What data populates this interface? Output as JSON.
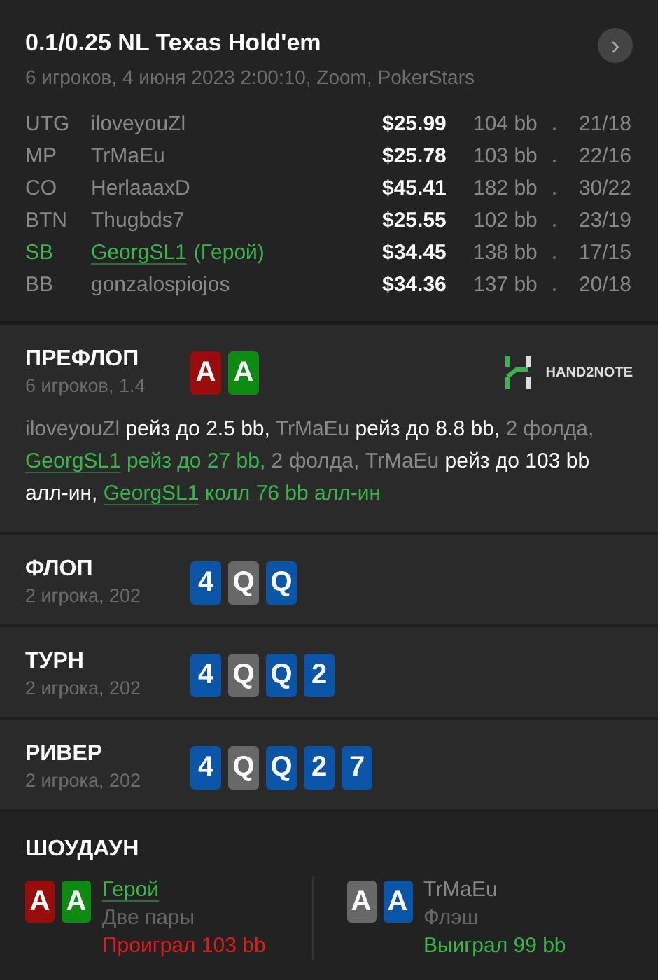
{
  "header": {
    "title": "0.1/0.25 NL Texas Hold'em",
    "subtitle": "6 игроков, 4 июня 2023 2:00:10, Zoom, PokerStars",
    "next_button": "›"
  },
  "players": [
    {
      "position": "UTG",
      "name": "iloveyouZl",
      "hero": false,
      "stack": "$25.99",
      "bb": "104 bb",
      "stats": "21/18"
    },
    {
      "position": "MP",
      "name": "TrMaEu",
      "hero": false,
      "stack": "$25.78",
      "bb": "103 bb",
      "stats": "22/16"
    },
    {
      "position": "CO",
      "name": "HerlaaaxD",
      "hero": false,
      "stack": "$45.41",
      "bb": "182 bb",
      "stats": "30/22"
    },
    {
      "position": "BTN",
      "name": "Thugbds7",
      "hero": false,
      "stack": "$25.55",
      "bb": "102 bb",
      "stats": "23/19"
    },
    {
      "position": "SB",
      "name": "GeorgSL1",
      "hero": true,
      "hero_label": "(Герой)",
      "stack": "$34.45",
      "bb": "138 bb",
      "stats": "17/15"
    },
    {
      "position": "BB",
      "name": "gonzalospiojos",
      "hero": false,
      "stack": "$34.36",
      "bb": "137 bb",
      "stats": "20/18"
    }
  ],
  "preflop": {
    "title": "ПРЕФЛОП",
    "subtitle": "6 игроков, 1.4",
    "cards": [
      {
        "rank": "A",
        "color": "#9a0b0b"
      },
      {
        "rank": "A",
        "color": "#0c8a12"
      }
    ],
    "logo": "HAND2NOTE",
    "actions": [
      {
        "kind": "name",
        "text": "iloveyouZl"
      },
      {
        "kind": "action",
        "text": " рейз до 2.5 bb,"
      },
      {
        "kind": "name",
        "text": " TrMaEu"
      },
      {
        "kind": "action",
        "text": " рейз до 8.8 bb,"
      },
      {
        "kind": "name",
        "text": " 2 фолда, "
      },
      {
        "kind": "hero",
        "text": "GeorgSL1"
      },
      {
        "kind": "hero_action",
        "text": " рейз до 27 bb,"
      },
      {
        "kind": "name",
        "text": " 2 фолда, TrMaEu"
      },
      {
        "kind": "action",
        "text": " рейз до 103 bb алл-ин, "
      },
      {
        "kind": "hero",
        "text": "GeorgSL1"
      },
      {
        "kind": "hero_action",
        "text": " колл 76 bb алл-ин"
      }
    ]
  },
  "streets": [
    {
      "title": "ФЛОП",
      "subtitle": "2 игрока, 202",
      "cards": [
        {
          "rank": "4",
          "color": "#0a55a8"
        },
        {
          "rank": "Q",
          "color": "#686868"
        },
        {
          "rank": "Q",
          "color": "#0a55a8"
        }
      ]
    },
    {
      "title": "ТУРН",
      "subtitle": "2 игрока, 202",
      "cards": [
        {
          "rank": "4",
          "color": "#0a55a8"
        },
        {
          "rank": "Q",
          "color": "#686868"
        },
        {
          "rank": "Q",
          "color": "#0a55a8"
        },
        {
          "rank": "2",
          "color": "#0a55a8"
        }
      ]
    },
    {
      "title": "РИВЕР",
      "subtitle": "2 игрока, 202",
      "cards": [
        {
          "rank": "4",
          "color": "#0a55a8"
        },
        {
          "rank": "Q",
          "color": "#686868"
        },
        {
          "rank": "Q",
          "color": "#0a55a8"
        },
        {
          "rank": "2",
          "color": "#0a55a8"
        },
        {
          "rank": "7",
          "color": "#0a55a8"
        }
      ]
    }
  ],
  "showdown": {
    "title": "ШОУДАУН",
    "hands": [
      {
        "name": "Герой",
        "hero": true,
        "hand": "Две пары",
        "result": "Проиграл 103 bb",
        "won": false,
        "cards": [
          {
            "rank": "A",
            "color": "#9a0b0b"
          },
          {
            "rank": "A",
            "color": "#0c8a12"
          }
        ]
      },
      {
        "name": "TrMaEu",
        "hero": false,
        "hand": "Флэш",
        "result": "Выиграл 99 bb",
        "won": true,
        "cards": [
          {
            "rank": "A",
            "color": "#686868"
          },
          {
            "rank": "A",
            "color": "#0a55a8"
          }
        ]
      }
    ]
  }
}
